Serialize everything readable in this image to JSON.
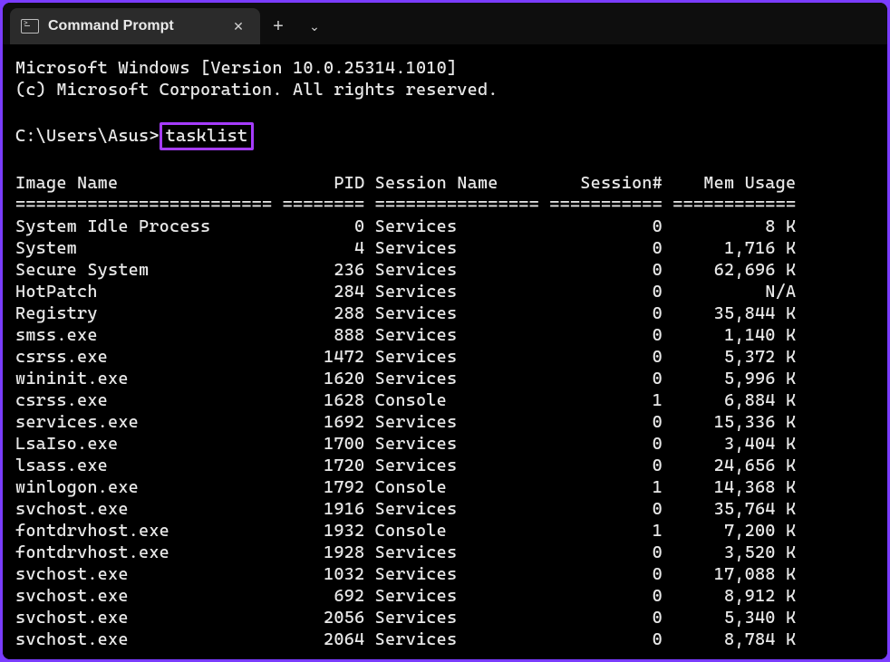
{
  "tab": {
    "title": "Command Prompt"
  },
  "header": {
    "line1": "Microsoft Windows [Version 10.0.25314.1010]",
    "line2": "(c) Microsoft Corporation. All rights reserved."
  },
  "prompt": {
    "path": "C:\\Users\\Asus>",
    "command": "tasklist"
  },
  "columns": {
    "image_name": "Image Name",
    "pid": "PID",
    "session_name": "Session Name",
    "session_no": "Session#",
    "mem_usage": "Mem Usage"
  },
  "widths": {
    "image_name": 25,
    "pid": 8,
    "session_name": 16,
    "session_no": 11,
    "mem_usage": 12
  },
  "rows": [
    {
      "image": "System Idle Process",
      "pid": 0,
      "sess": "Services",
      "sno": 0,
      "mem": "8 K"
    },
    {
      "image": "System",
      "pid": 4,
      "sess": "Services",
      "sno": 0,
      "mem": "1,716 K"
    },
    {
      "image": "Secure System",
      "pid": 236,
      "sess": "Services",
      "sno": 0,
      "mem": "62,696 K"
    },
    {
      "image": "HotPatch",
      "pid": 284,
      "sess": "Services",
      "sno": 0,
      "mem": "N/A"
    },
    {
      "image": "Registry",
      "pid": 288,
      "sess": "Services",
      "sno": 0,
      "mem": "35,844 K"
    },
    {
      "image": "smss.exe",
      "pid": 888,
      "sess": "Services",
      "sno": 0,
      "mem": "1,140 K"
    },
    {
      "image": "csrss.exe",
      "pid": 1472,
      "sess": "Services",
      "sno": 0,
      "mem": "5,372 K"
    },
    {
      "image": "wininit.exe",
      "pid": 1620,
      "sess": "Services",
      "sno": 0,
      "mem": "5,996 K"
    },
    {
      "image": "csrss.exe",
      "pid": 1628,
      "sess": "Console",
      "sno": 1,
      "mem": "6,884 K"
    },
    {
      "image": "services.exe",
      "pid": 1692,
      "sess": "Services",
      "sno": 0,
      "mem": "15,336 K"
    },
    {
      "image": "LsaIso.exe",
      "pid": 1700,
      "sess": "Services",
      "sno": 0,
      "mem": "3,404 K"
    },
    {
      "image": "lsass.exe",
      "pid": 1720,
      "sess": "Services",
      "sno": 0,
      "mem": "24,656 K"
    },
    {
      "image": "winlogon.exe",
      "pid": 1792,
      "sess": "Console",
      "sno": 1,
      "mem": "14,368 K"
    },
    {
      "image": "svchost.exe",
      "pid": 1916,
      "sess": "Services",
      "sno": 0,
      "mem": "35,764 K"
    },
    {
      "image": "fontdrvhost.exe",
      "pid": 1932,
      "sess": "Console",
      "sno": 1,
      "mem": "7,200 K"
    },
    {
      "image": "fontdrvhost.exe",
      "pid": 1928,
      "sess": "Services",
      "sno": 0,
      "mem": "3,520 K"
    },
    {
      "image": "svchost.exe",
      "pid": 1032,
      "sess": "Services",
      "sno": 0,
      "mem": "17,088 K"
    },
    {
      "image": "svchost.exe",
      "pid": 692,
      "sess": "Services",
      "sno": 0,
      "mem": "8,912 K"
    },
    {
      "image": "svchost.exe",
      "pid": 2056,
      "sess": "Services",
      "sno": 0,
      "mem": "5,340 K"
    },
    {
      "image": "svchost.exe",
      "pid": 2064,
      "sess": "Services",
      "sno": 0,
      "mem": "8,784 K"
    }
  ]
}
